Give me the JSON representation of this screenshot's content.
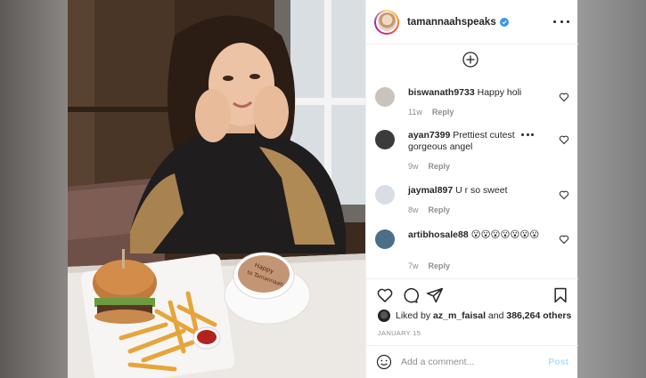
{
  "header": {
    "username": "tamannaahspeaks",
    "verified": true
  },
  "comments": [
    {
      "user": "biswanath9733",
      "text": "Happy holi",
      "age": "11w",
      "reply": "Reply",
      "avatar_color": "#c9c2bd"
    },
    {
      "user": "ayan7399",
      "text": "Prettiest cutest gorgeous angel",
      "age": "9w",
      "reply": "Reply",
      "avatar_color": "#3b3b3b"
    },
    {
      "user": "jaymal897",
      "text": "U r so sweet",
      "age": "8w",
      "reply": "Reply",
      "avatar_color": "#d9dde4"
    },
    {
      "user": "artibhosale88",
      "text": "😮😮😮😮😮😮😮",
      "age": "7w",
      "reply": "Reply",
      "avatar_color": "#4a6f86"
    }
  ],
  "likes": {
    "prefix": "Liked by",
    "first_user": "az_m_faisal",
    "joiner": "and",
    "others": "386,264 others"
  },
  "date": "JANUARY 15",
  "comment_box": {
    "placeholder": "Add a comment...",
    "post_label": "Post"
  },
  "photo": {
    "cup_text_line1": "Happy",
    "cup_text_line2": "to Tamannaah"
  },
  "colors": {
    "text": "#262626",
    "meta": "#8e8e8e",
    "verified": "#3897f0",
    "post_disabled": "#b2dffc",
    "border": "#efefef"
  }
}
